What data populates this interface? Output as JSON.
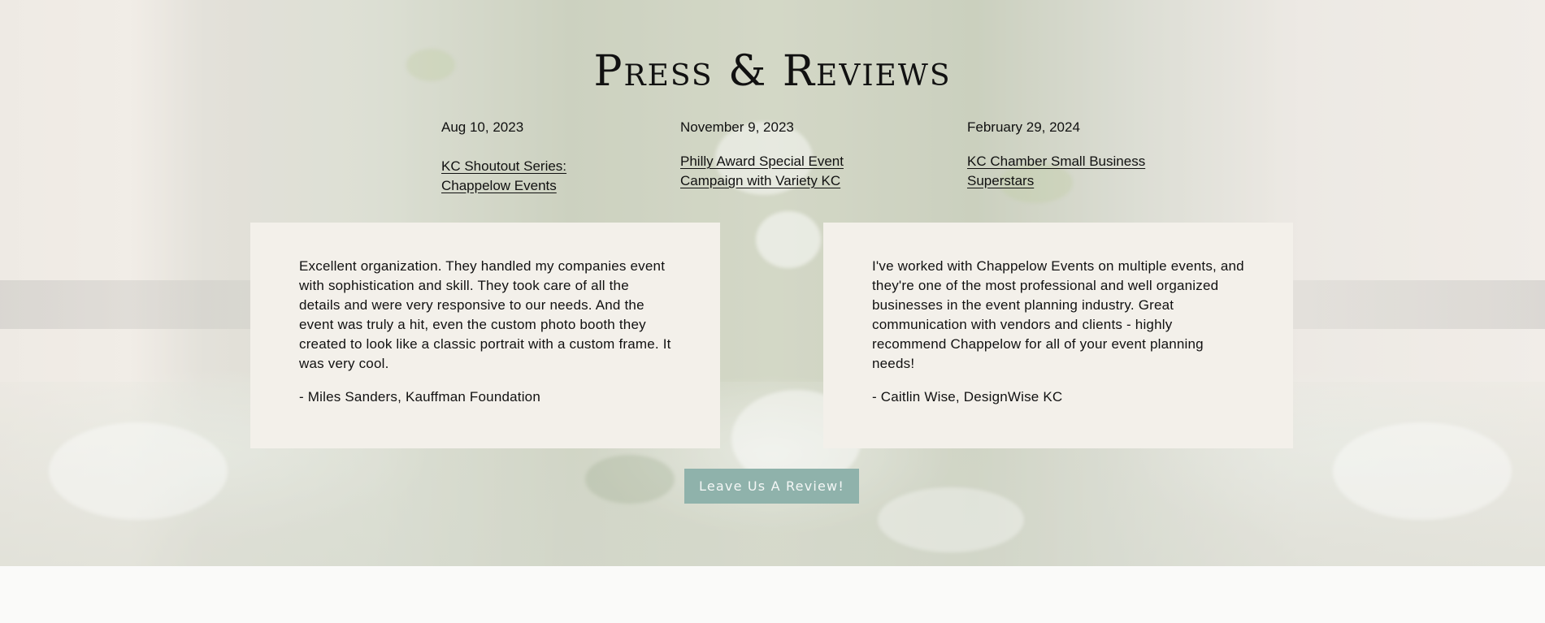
{
  "section": {
    "title": "Press & Reviews"
  },
  "press": [
    {
      "date": "Aug 10, 2023",
      "link": "KC Shoutout Series: Chappelow Events"
    },
    {
      "date": "November 9, 2023",
      "link": "Philly Award Special Event Campaign with Variety KC"
    },
    {
      "date": "February 29, 2024",
      "link": "KC Chamber Small Business Superstars"
    }
  ],
  "reviews": [
    {
      "quote": "Excellent organization. They handled my companies event with sophistication and skill. They took care of all the details and were very responsive to our needs. And the event was truly a hit, even the custom photo booth they created to look like a classic portrait with a custom frame. It was very cool.",
      "author": "- Miles Sanders, Kauffman Foundation"
    },
    {
      "quote": "I've worked with Chappelow Events on multiple events, and they're one of the most professional and well organized businesses in the event planning industry. Great communication with vendors and clients - highly recommend Chappelow for all of your event planning needs!",
      "author": "- Caitlin Wise, DesignWise KC"
    }
  ],
  "cta": {
    "label": "Leave Us A Review!"
  },
  "colors": {
    "card_bg": "#f3f0ea",
    "button_bg": "#8fb2ab",
    "button_text": "#f4f7f6",
    "text": "#111111"
  }
}
